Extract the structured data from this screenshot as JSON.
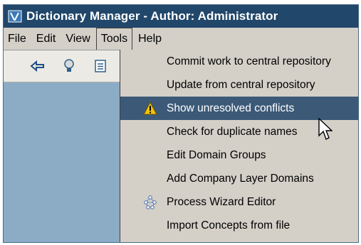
{
  "window": {
    "title": "Dictionary Manager - Author: Administrator"
  },
  "menubar": {
    "items": [
      {
        "label": "File"
      },
      {
        "label": "Edit"
      },
      {
        "label": "View"
      },
      {
        "label": "Tools",
        "active": true
      },
      {
        "label": "Help"
      }
    ]
  },
  "toolbar": {
    "icons": [
      "swap-arrow-icon",
      "lightbulb-icon",
      "list-icon"
    ]
  },
  "tools_menu": {
    "items": [
      {
        "label": "Commit work to central repository"
      },
      {
        "label": "Update from central repository"
      },
      {
        "label": "Show unresolved conflicts",
        "icon": "warning-icon",
        "highlighted": true
      },
      {
        "label": "Check for duplicate names"
      },
      {
        "label": "Edit Domain Groups"
      },
      {
        "label": "Add Company Layer Domains"
      },
      {
        "label": "Process Wizard Editor",
        "icon": "wizard-network-icon"
      },
      {
        "label": "Import Concepts from file"
      }
    ]
  },
  "colors": {
    "titlebar": "#21476a",
    "menu_bg": "#d4d0c8",
    "highlight": "#3c5a78",
    "side_panel": "#8cacc6"
  }
}
